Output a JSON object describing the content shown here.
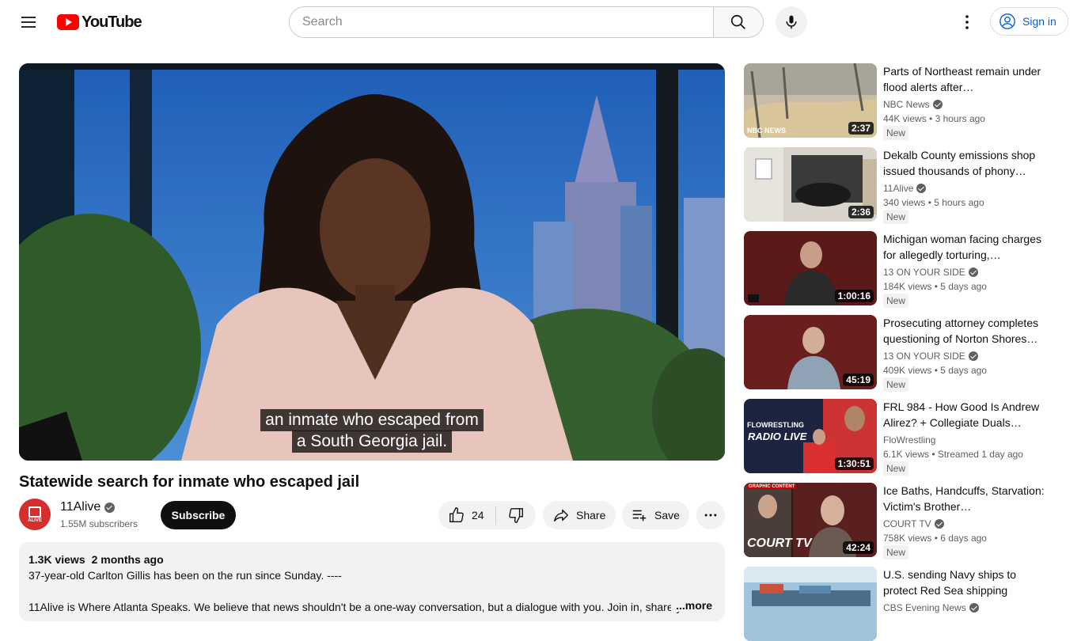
{
  "header": {
    "logo_text": "YouTube",
    "search_placeholder": "Search",
    "sign_in_label": "Sign in"
  },
  "player": {
    "caption_line_1": "an inmate who escaped from",
    "caption_line_2": "a South Georgia jail."
  },
  "video": {
    "title": "Statewide search for inmate who escaped jail",
    "channel_name": "11Alive",
    "channel_avatar_text": "ALIVE",
    "subscribers": "1.55M subscribers",
    "subscribe_label": "Subscribe",
    "like_count": "24",
    "share_label": "Share",
    "save_label": "Save"
  },
  "description": {
    "views": "1.3K views",
    "date": "2 months ago",
    "line_1": "37-year-old Carlton Gillis has been on the run since Sunday. ----",
    "line_2": "11Alive is Where Atlanta Speaks. We believe that news shouldn't be a one-way conversation, but a dialogue with you. Join in, share y",
    "more_label": "...more"
  },
  "recommendations": [
    {
      "title": "Parts of Northeast remain under flood alerts after…",
      "channel": "NBC News",
      "verified": true,
      "views": "44K views",
      "age": "3 hours ago",
      "badge": "New",
      "duration": "2:37",
      "thumb_tag": "NBC NEWS"
    },
    {
      "title": "Dekalb County emissions shop issued thousands of phony…",
      "channel": "11Alive",
      "verified": true,
      "views": "340 views",
      "age": "5 hours ago",
      "badge": "New",
      "duration": "2:36"
    },
    {
      "title": "Michigan woman facing charges for allegedly torturing,…",
      "channel": "13 ON YOUR SIDE",
      "verified": true,
      "views": "184K views",
      "age": "5 days ago",
      "badge": "New",
      "duration": "1:00:16"
    },
    {
      "title": "Prosecuting attorney completes questioning of Norton Shores…",
      "channel": "13 ON YOUR SIDE",
      "verified": true,
      "views": "409K views",
      "age": "5 days ago",
      "badge": "New",
      "duration": "45:19"
    },
    {
      "title": "FRL 984 - How Good Is Andrew Alirez? + Collegiate Duals…",
      "channel": "FloWrestling",
      "verified": false,
      "views": "6.1K views",
      "age": "Streamed 1 day ago",
      "badge": "New",
      "duration": "1:30:51",
      "thumb_tag": "FLOWRESTLING",
      "thumb_big": "RADIO LIVE"
    },
    {
      "title": "Ice Baths, Handcuffs, Starvation: Victim's Brother…",
      "channel": "COURT TV",
      "verified": true,
      "views": "758K views",
      "age": "6 days ago",
      "badge": "New",
      "duration": "42:24",
      "thumb_tag": "GRAPHIC CONTENT",
      "thumb_big": "COURT TV"
    },
    {
      "title": "U.S. sending Navy ships to protect Red Sea shipping",
      "channel": "CBS Evening News",
      "verified": true,
      "views": "",
      "age": "",
      "badge": ""
    }
  ],
  "colors": {
    "brand_red": "#ff0000",
    "link_blue": "#065fd4",
    "text_secondary": "#606060"
  }
}
